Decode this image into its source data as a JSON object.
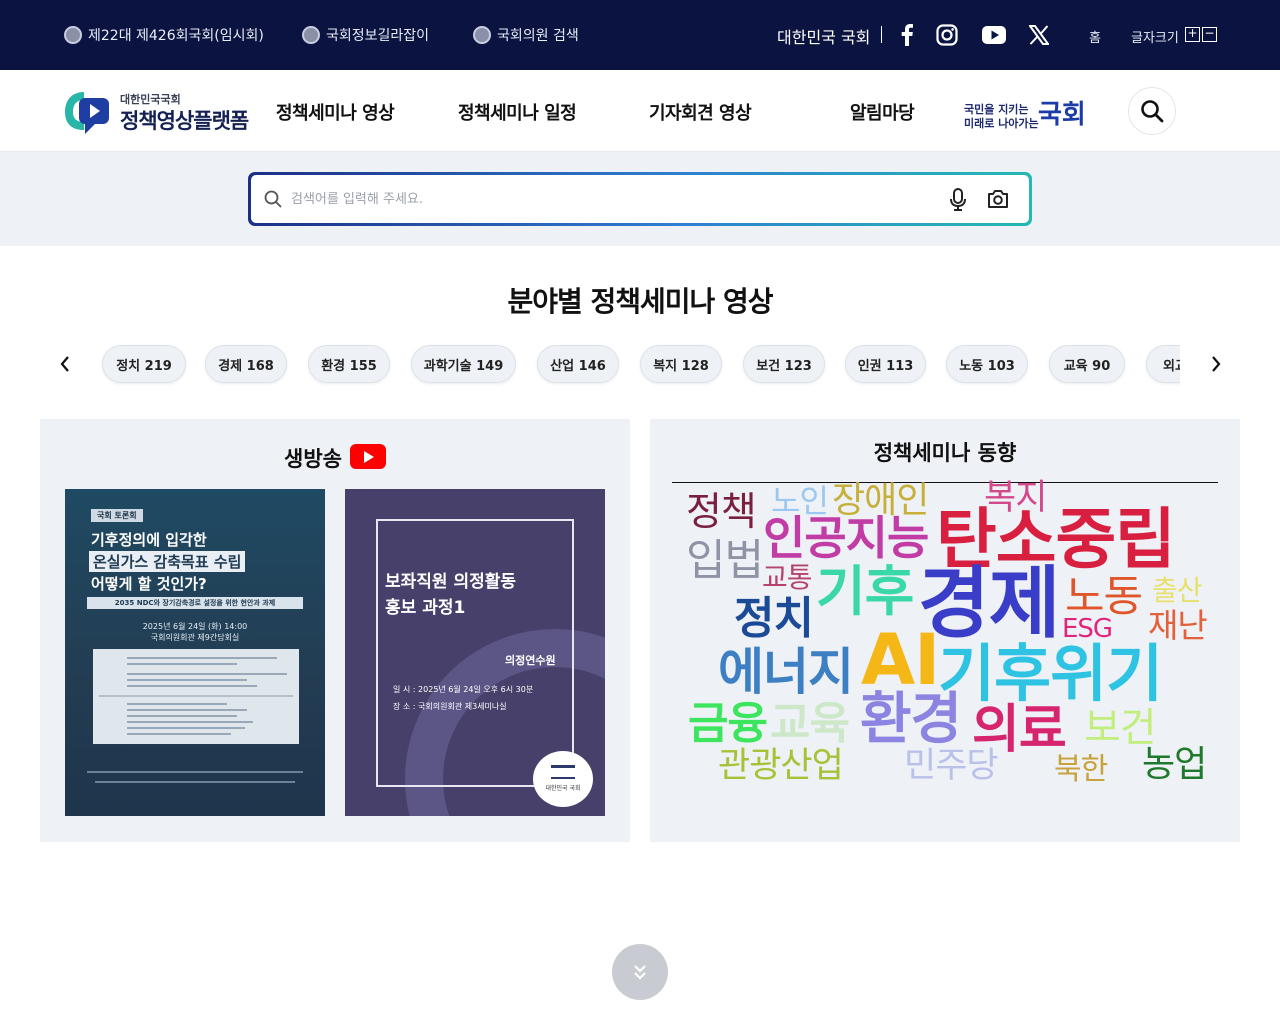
{
  "topbar": {
    "links": [
      {
        "label": "제22대 제426회국회(임시회)"
      },
      {
        "label": "국회정보길라잡이"
      },
      {
        "label": "국회의원 검색"
      }
    ],
    "assembly_label": "대한민국 국회",
    "home_label": "홈",
    "font_size_label": "글자크기",
    "font_plus": "+",
    "font_minus": "−"
  },
  "nav": {
    "logo_sub": "대한민국국회",
    "logo_main": "정책영상플랫폼",
    "menu": [
      "정책세미나 영상",
      "정책세미나 일정",
      "기자회견 영상",
      "알림마당"
    ],
    "slogan_line1": "국민을 지키는",
    "slogan_line2": "미래로 나아가는",
    "slogan_big": "국회"
  },
  "search": {
    "placeholder": "검색어를 입력해 주세요."
  },
  "section": {
    "title": "분야별 정책세미나 영상"
  },
  "categories": [
    {
      "label": "정치 219"
    },
    {
      "label": "경제 168"
    },
    {
      "label": "환경 155"
    },
    {
      "label": "과학기술 149"
    },
    {
      "label": "산업 146"
    },
    {
      "label": "복지 128"
    },
    {
      "label": "보건 123"
    },
    {
      "label": "인권 113"
    },
    {
      "label": "노동 103"
    },
    {
      "label": "교육 90"
    },
    {
      "label": "외교"
    }
  ],
  "live": {
    "title": "생방송",
    "posters": [
      {
        "tag": "국회 토론회",
        "line1": "기후정의에 입각한",
        "line2": "온실가스 감축목표 수립",
        "line3": "어떻게 할 것인가?",
        "subtitle": "2035 NDC와 장기감축경로 설정을 위한 현안과 과제",
        "date": "2025년 6월 24일 (화) 14:00",
        "place": "국회의원회관 제9간담회실"
      },
      {
        "title_line1": "보좌직원 의정활동",
        "title_line2": "홍보 과정1",
        "org": "의정연수원",
        "date": "일 시 : 2025년 6월 24일 오후 6시 30분",
        "place": "장 소 : 국회의원회관 제3세미나실",
        "seal": "대한민국 국회"
      }
    ]
  },
  "trend": {
    "title": "정책세미나 동향",
    "words": [
      {
        "text": "정책",
        "color": "#7a1f3d"
      },
      {
        "text": "노인",
        "color": "#9ac8f0"
      },
      {
        "text": "장애인",
        "color": "#c7b03a"
      },
      {
        "text": "복지",
        "color": "#d24a8c"
      },
      {
        "text": "탄소중립",
        "color": "#d81f3f"
      },
      {
        "text": "인공지능",
        "color": "#c23ca6"
      },
      {
        "text": "입법",
        "color": "#8f93a6"
      },
      {
        "text": "교통",
        "color": "#b6436e"
      },
      {
        "text": "기후",
        "color": "#3ad8a9"
      },
      {
        "text": "경제",
        "color": "#3a3dc7"
      },
      {
        "text": "노동",
        "color": "#e0562a"
      },
      {
        "text": "출산",
        "color": "#e8e06c"
      },
      {
        "text": "정치",
        "color": "#1b4a96"
      },
      {
        "text": "ESG",
        "color": "#e0257d"
      },
      {
        "text": "재난",
        "color": "#e3613a"
      },
      {
        "text": "에너지",
        "color": "#3c7fc2"
      },
      {
        "text": "AI",
        "color": "#f5b716"
      },
      {
        "text": "기후위기",
        "color": "#2ec3e3"
      },
      {
        "text": "금융",
        "color": "#3de55e"
      },
      {
        "text": "교육",
        "color": "#cde8c9"
      },
      {
        "text": "환경",
        "color": "#8b84e0"
      },
      {
        "text": "의료",
        "color": "#d6246e"
      },
      {
        "text": "보건",
        "color": "#c2ee7d"
      },
      {
        "text": "관광산업",
        "color": "#a8c238"
      },
      {
        "text": "민주당",
        "color": "#b9c1ea"
      },
      {
        "text": "북한",
        "color": "#c8a23a"
      },
      {
        "text": "농업",
        "color": "#1e7a2a"
      }
    ]
  }
}
